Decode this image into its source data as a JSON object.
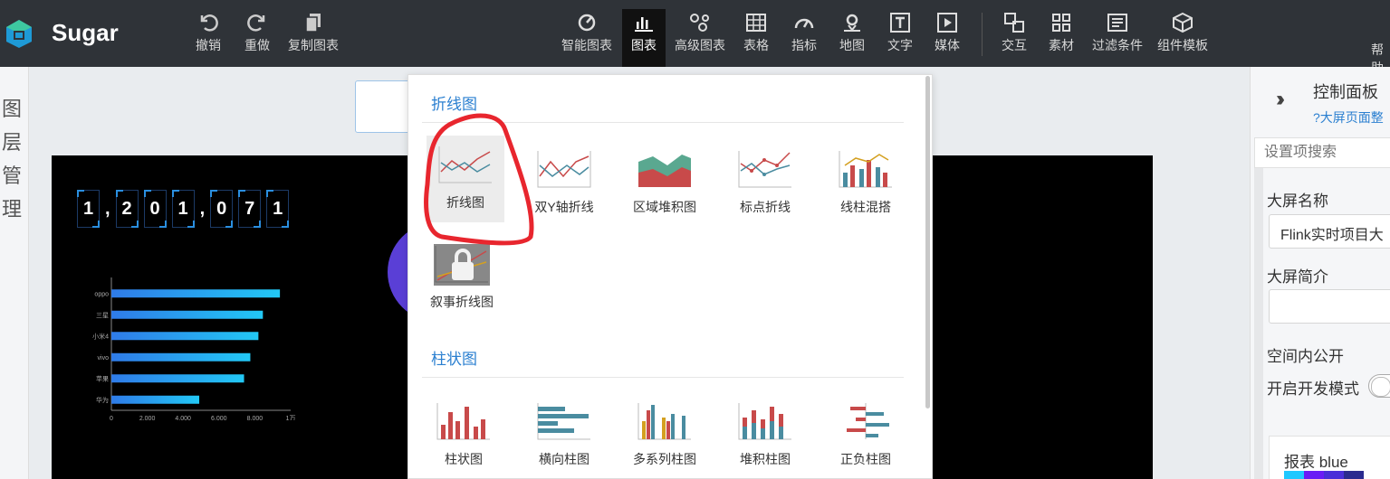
{
  "brand": {
    "name": "Sugar"
  },
  "toolbar": {
    "undo": "撤销",
    "redo": "重做",
    "copy_chart": "复制图表",
    "smart_chart": "智能图表",
    "chart": "图表",
    "advanced_chart": "高级图表",
    "table": "表格",
    "indicator": "指标",
    "map": "地图",
    "text": "文字",
    "media": "媒体",
    "interaction": "交互",
    "material": "素材",
    "filter": "过滤条件",
    "component_template": "组件模板",
    "help": "帮助"
  },
  "left_panel": {
    "label": "图层管理"
  },
  "canvas": {
    "counter": [
      "1",
      ",",
      "2",
      "0",
      "1",
      ",",
      "0",
      "7",
      "1"
    ],
    "bar_chart": {
      "type": "bar",
      "categories": [
        "oppo",
        "三星",
        "小米4",
        "vivo",
        "苹果",
        "华为"
      ],
      "values": [
        9400,
        8450,
        8200,
        7750,
        7400,
        4900
      ],
      "x_ticks": [
        "0",
        "2,000",
        "4,000",
        "6,000",
        "8,000",
        "1万"
      ],
      "xlim": [
        0,
        10000
      ]
    }
  },
  "dropdown": {
    "line_section": {
      "title": "折线图",
      "items": [
        "折线图",
        "双Y轴折线",
        "区域堆积图",
        "标点折线",
        "线柱混搭",
        "叙事折线图"
      ]
    },
    "bar_section": {
      "title": "柱状图",
      "items": [
        "柱状图",
        "横向柱图",
        "多系列柱图",
        "堆积柱图",
        "正负柱图"
      ]
    }
  },
  "right_panel": {
    "title": "控制面板",
    "help_link": "?大屏页面整",
    "search_placeholder": "设置项搜索",
    "screen_name_label": "大屏名称",
    "screen_name_value": "Flink实时项目大",
    "screen_desc_label": "大屏简介",
    "public_label": "空间内公开",
    "dev_mode_label": "开启开发模式",
    "theme_card": {
      "text": "报表   blue",
      "colors": [
        "#1ec8ff",
        "#6a1cf5",
        "#4a2fd8",
        "#2b2b8f"
      ]
    }
  },
  "accent": {
    "blue": "#2a7fd0",
    "red_annotation": "#e8262e"
  }
}
